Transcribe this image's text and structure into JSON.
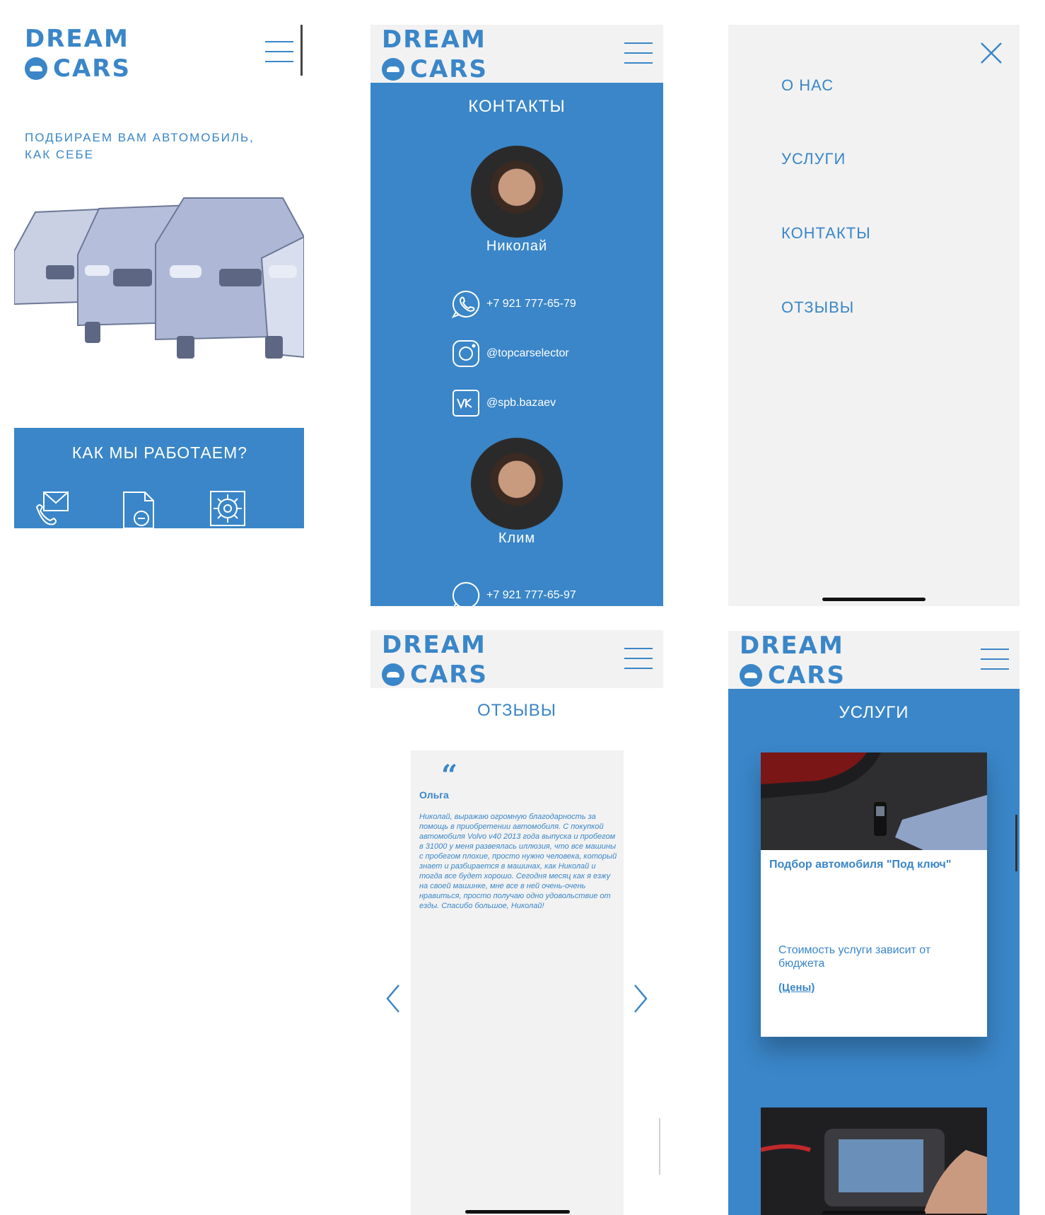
{
  "brand": {
    "line1": "DREAM",
    "line2": "CARS"
  },
  "colors": {
    "accent": "#3a86c8",
    "panel": "#f2f2f2",
    "text_on_accent": "#ffffff"
  },
  "home": {
    "tagline_1": "ПОДБИРАЕМ ВАМ АВТОМОБИЛЬ,",
    "tagline_2": "КАК СЕБЕ",
    "how_we_work": "КАК МЫ РАБОТАЕМ?",
    "steps": [
      {
        "icon": "phone-envelope-icon"
      },
      {
        "icon": "document-search-icon"
      },
      {
        "icon": "gear-blueprint-icon"
      }
    ]
  },
  "contacts": {
    "title": "КОНТАКТЫ",
    "people": [
      {
        "name": "Николай",
        "phone": "+7 921 777-65-79",
        "instagram": "@topcarselector",
        "vk": "@spb.bazaev"
      },
      {
        "name": "Клим",
        "phone": "+7 921 777-65-97"
      }
    ]
  },
  "menu": {
    "items": [
      "О НАС",
      "УСЛУГИ",
      "КОНТАКТЫ",
      "ОТЗЫВЫ"
    ]
  },
  "reviews": {
    "title": "ОТЗЫВЫ",
    "author": "Ольга",
    "text": "Николай, выражаю огромную благодарность за помощь в приобретении автомобиля. С покупкой автомобиля Volvo v40 2013 года выпуска и пробегом в 31000 у меня развеялась иллюзия, что все машины с пробегом плохие, просто нужно человека, который знает и разбирается в машинах, как Николай и тогда все будет хорошо. Сегодня месяц как я езжу на своей машинке, мне все в ней очень-очень нравиться, просто получаю одно удовольствие от езды. Спасибо большое, Николай!"
  },
  "services": {
    "title": "УСЛУГИ",
    "card_title": "Подбор автомобиля \"Под ключ\"",
    "card_desc": "Стоимость услуги зависит от бюджета",
    "card_link": "(Цены)"
  }
}
